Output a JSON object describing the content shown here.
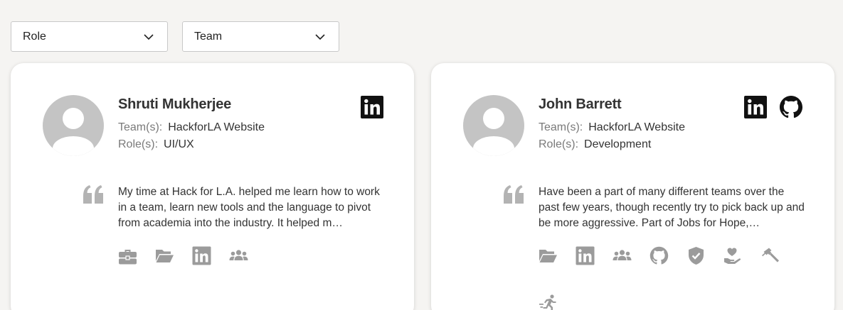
{
  "filters": {
    "role_label": "Role",
    "team_label": "Team"
  },
  "colors": {
    "background": "#f5f4f2",
    "card": "#ffffff",
    "avatar": "#c4c4c4",
    "badge_icon": "#9b9b9b",
    "text": "#333333"
  },
  "members": [
    {
      "name": "Shruti Mukherjee",
      "team_key": "Team(s):",
      "team": "HackforLA Website",
      "role_key": "Role(s):",
      "role": "UI/UX",
      "social": [
        "linkedin-icon"
      ],
      "quote": "My time at Hack for L.A. helped me learn how to work in a team, learn new tools and the language to pivot from academia into the industry. It helped m…",
      "badges": [
        "briefcase-icon",
        "folder-open-icon",
        "linkedin-icon",
        "group-icon"
      ]
    },
    {
      "name": "John Barrett",
      "team_key": "Team(s):",
      "team": "HackforLA Website",
      "role_key": "Role(s):",
      "role": "Development",
      "social": [
        "linkedin-icon",
        "github-icon"
      ],
      "quote": "Have been a part of many different teams over the past few years, though recently try to pick back up and be more aggressive. Part of Jobs for Hope,…",
      "badges": [
        "folder-open-icon",
        "linkedin-icon",
        "group-icon",
        "github-icon",
        "shield-check-icon",
        "hand-heart-icon",
        "hammer-icon",
        "running-icon"
      ]
    }
  ]
}
